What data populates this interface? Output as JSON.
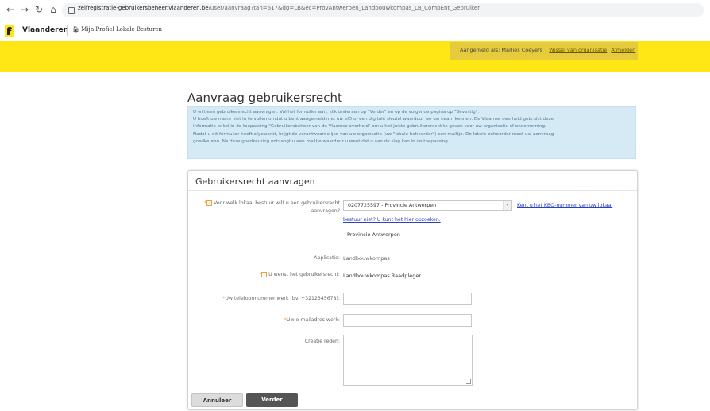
{
  "browser": {
    "url_domain": "zelfregistratie-gebruikersbeheer.vlaanderen.be",
    "url_path": "/user/aanvraag?tan=617&dg=LB&ec=ProvAntwerpen_Landbouwkompas_LB_CompEnt_Gebruiker"
  },
  "header": {
    "brand": "Vlaanderen",
    "home_link": "Mijn Profiel Lokale Besturen"
  },
  "user_bar": {
    "logged_in_as": "Aangemeld als: Marlies Coeyers",
    "switch_org": "Wissel van organisatie",
    "logout": "Afmelden"
  },
  "page_title": "Aanvraag gebruikersrecht",
  "info_lines": [
    "U wilt een gebruikersrecht aanvragen. Vul het formulier aan, klik onderaan op \"Verder\" en op de volgende pagina op \"Bevestig\".",
    "U hoeft uw naam niet in te vullen omdat u bent aangemeld met uw eID of een digitale sleutel waardoor we uw naam kennen. De Vlaamse overheid gebruikt deze",
    "informatie enkel in de toepassing \"Gebruikersbeheer van de Vlaamse overheid\" om u het juiste gebruikersrecht te geven voor uw organisatie of onderneming.",
    "Nadat u dit formulier heeft afgewerkt, krijgt de verantwoordelijke van uw organisatie (uw \"lokale beheerder\") een mailtje. De lokale beheerder moet uw aanvraag",
    "goedkeuren. Na deze goedkeuring ontvangt u een mailtje waardoor u weet dat u aan de slag kan in de toepassing."
  ],
  "form": {
    "title": "Gebruikersrecht aanvragen",
    "bestuur_label_1": "Voor welk lokaal bestuur wilt u een gebruikersrecht",
    "bestuur_label_2": "aanvragen?",
    "bestuur_selected": "0207725597 - Provincie Antwerpen",
    "kbo_link_1": "Kent u het KBO-nummer van uw lokaal",
    "kbo_link_2": "bestuur niet? U kunt het hier opzoeken.",
    "bestuur_name": "Provincie Antwerpen",
    "applicatie_label": "Applicatie:",
    "applicatie_value": "Landbouwkompas",
    "recht_label": "U wenst het gebruikersrecht:",
    "recht_value": "Landbouwkompas Raadpleger",
    "phone_label": "Uw telefoonnummer werk (bv. +3212345678):",
    "email_label": "Uw e-mailadres werk:",
    "reason_label": "Creatie reden:",
    "phone_value": "",
    "email_value": "",
    "reason_value": "",
    "cancel_button": "Annuleer",
    "next_button": "Verder"
  },
  "colors": {
    "accent_yellow": "#ffe615",
    "info_bg": "#d6eaf5",
    "required": "#e8a13b",
    "link": "#2b3fbf"
  }
}
